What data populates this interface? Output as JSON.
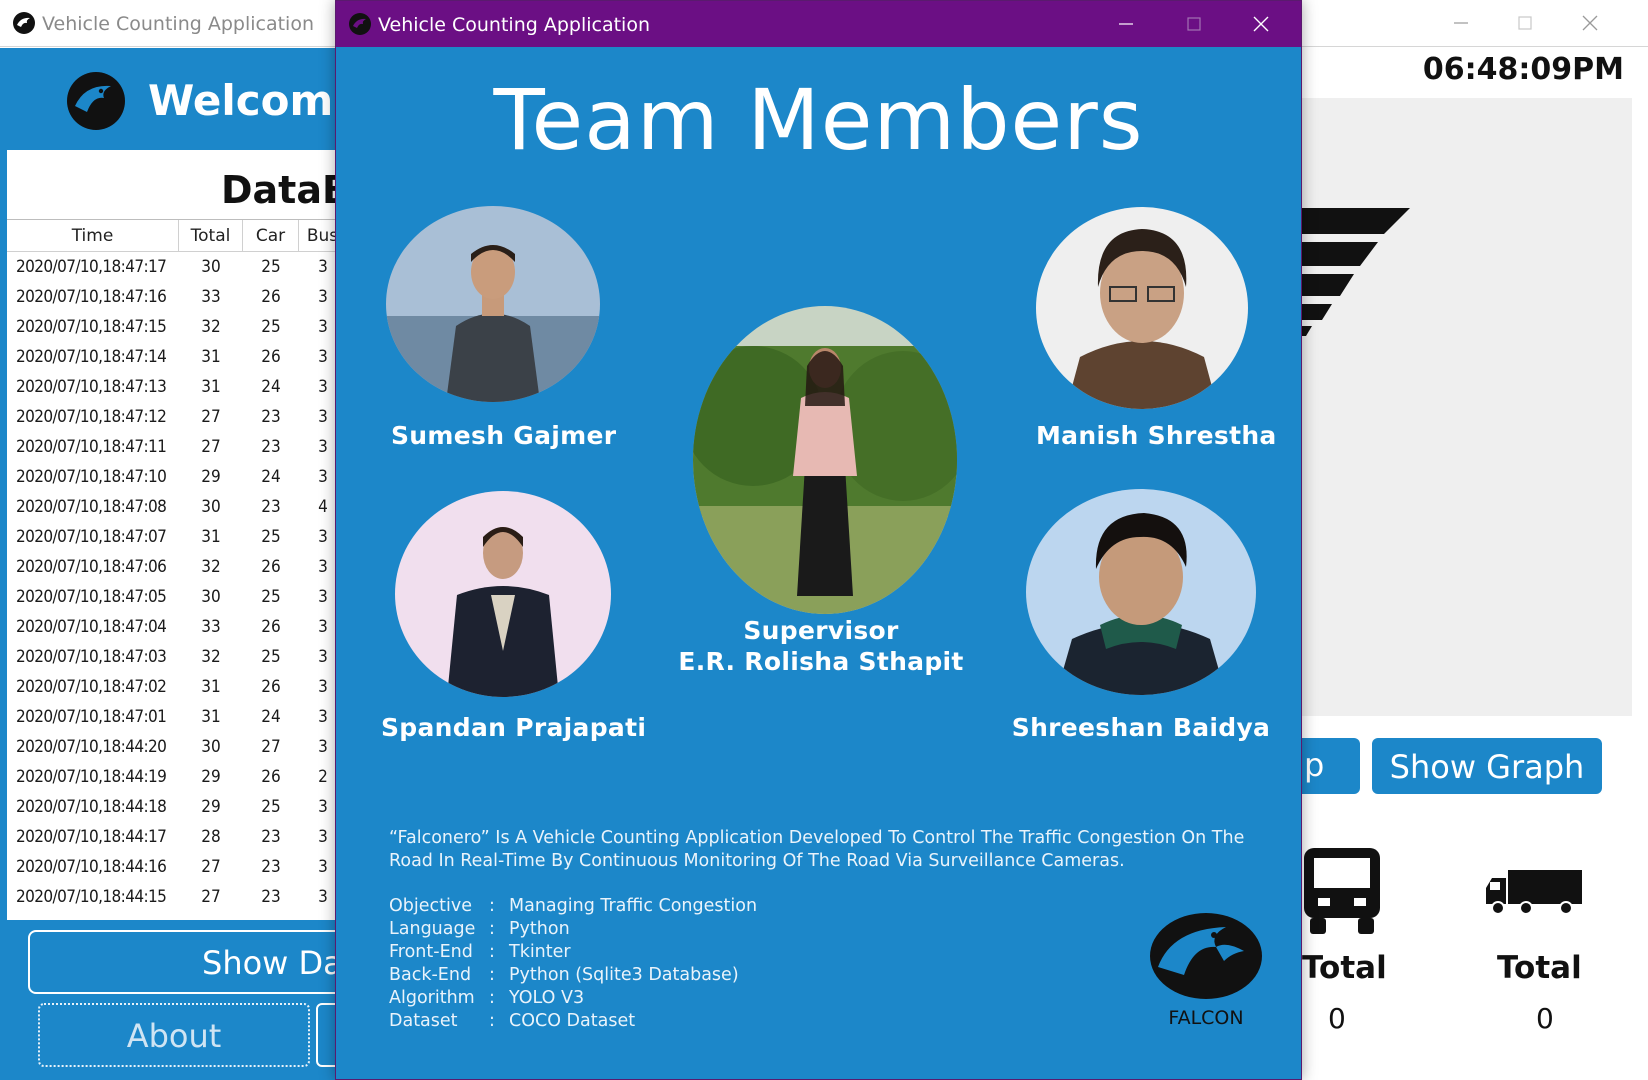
{
  "background_window": {
    "title": "Vehicle Counting Application",
    "welcome": "Welcome",
    "database_title": "DataB",
    "clock": "06:48:09PM",
    "table": {
      "headers": [
        "Time",
        "Total",
        "Car",
        "Bus"
      ],
      "rows": [
        [
          "2020/07/10,18:47:17",
          "30",
          "25",
          "3"
        ],
        [
          "2020/07/10,18:47:16",
          "33",
          "26",
          "3"
        ],
        [
          "2020/07/10,18:47:15",
          "32",
          "25",
          "3"
        ],
        [
          "2020/07/10,18:47:14",
          "31",
          "26",
          "3"
        ],
        [
          "2020/07/10,18:47:13",
          "31",
          "24",
          "3"
        ],
        [
          "2020/07/10,18:47:12",
          "27",
          "23",
          "3"
        ],
        [
          "2020/07/10,18:47:11",
          "27",
          "23",
          "3"
        ],
        [
          "2020/07/10,18:47:10",
          "29",
          "24",
          "3"
        ],
        [
          "2020/07/10,18:47:08",
          "30",
          "23",
          "4"
        ],
        [
          "2020/07/10,18:47:07",
          "31",
          "25",
          "3"
        ],
        [
          "2020/07/10,18:47:06",
          "32",
          "26",
          "3"
        ],
        [
          "2020/07/10,18:47:05",
          "30",
          "25",
          "3"
        ],
        [
          "2020/07/10,18:47:04",
          "33",
          "26",
          "3"
        ],
        [
          "2020/07/10,18:47:03",
          "32",
          "25",
          "3"
        ],
        [
          "2020/07/10,18:47:02",
          "31",
          "26",
          "3"
        ],
        [
          "2020/07/10,18:47:01",
          "31",
          "24",
          "3"
        ],
        [
          "2020/07/10,18:44:20",
          "30",
          "27",
          "3"
        ],
        [
          "2020/07/10,18:44:19",
          "29",
          "26",
          "2"
        ],
        [
          "2020/07/10,18:44:18",
          "29",
          "25",
          "3"
        ],
        [
          "2020/07/10,18:44:17",
          "28",
          "23",
          "3"
        ],
        [
          "2020/07/10,18:44:16",
          "27",
          "23",
          "3"
        ],
        [
          "2020/07/10,18:44:15",
          "27",
          "23",
          "3"
        ]
      ]
    },
    "show_data_label": "Show Da",
    "about_label": "About",
    "partial_button_label": "p",
    "show_graph_label": "Show Graph",
    "bus_total_label": "Total",
    "bus_total_value": "0",
    "truck_total_label": "Total",
    "truck_total_value": "0"
  },
  "dialog": {
    "title": "Vehicle Counting Application",
    "heading": "Team Members",
    "members": {
      "top_left": "Sumesh Gajmer",
      "top_right": "Manish Shrestha",
      "bottom_left": "Spandan Prajapati",
      "bottom_right": "Shreeshan Baidya",
      "supervisor_title": "Supervisor",
      "supervisor_name": "E.R.  Rolisha Sthapit"
    },
    "description": "“Falconero” Is  A Vehicle Counting Application Developed To Control The Traffic Congestion On The Road In Real-Time By Continuous Monitoring Of The Road Via Surveillance Cameras.",
    "info": [
      {
        "key": "Objective",
        "sep": ":",
        "value": "Managing Traffic Congestion"
      },
      {
        "key": "Language",
        "sep": ":",
        "value": "Python"
      },
      {
        "key": "Front-End",
        "sep": ":",
        "value": "Tkinter"
      },
      {
        "key": "Back-End",
        "sep": ":",
        "value": "Python (Sqlite3 Database)"
      },
      {
        "key": "Algorithm",
        "sep": ":",
        "value": "YOLO V3"
      },
      {
        "key": "Dataset",
        "sep": ":",
        "value": "COCO Dataset"
      }
    ],
    "logo_text": "FALCON"
  },
  "colors": {
    "app_blue": "#1c87c9",
    "dialog_titlebar": "#6b0f84"
  }
}
